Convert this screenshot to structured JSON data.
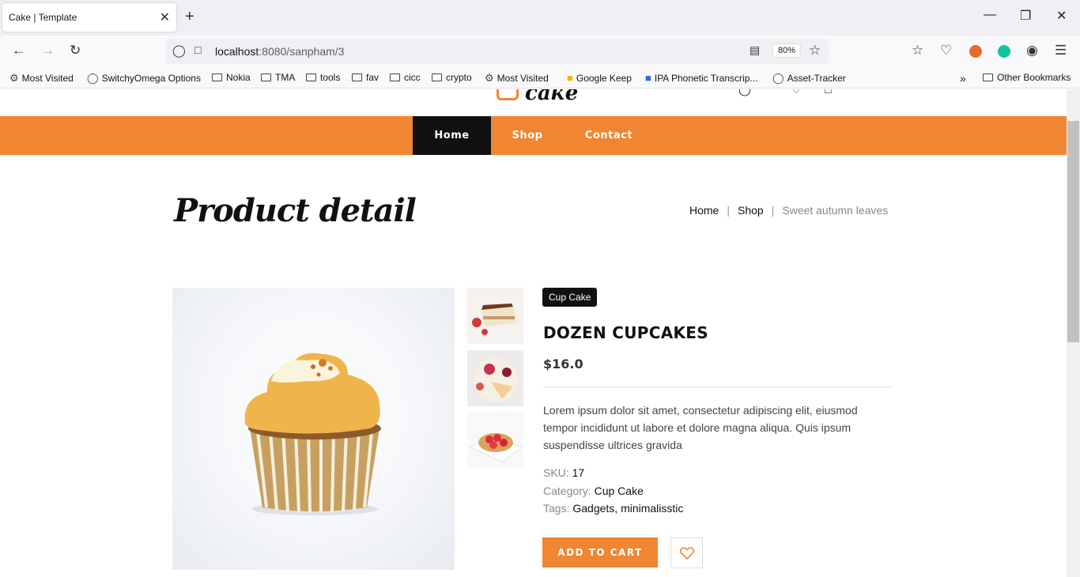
{
  "browser": {
    "tab_title": "Cake | Template",
    "tab_close": "✕",
    "new_tab": "+",
    "url_host": "localhost",
    "url_rest": ":8080/sanpham/3",
    "zoom": "80%",
    "bookmarks": [
      "Most Visited",
      "SwitchyOmega Options",
      "Nokia",
      "TMA",
      "tools",
      "fav",
      "cicc",
      "crypto",
      "Most Visited",
      "Google Keep",
      "IPA Phonetic Transcrip...",
      "Asset-Tracker"
    ],
    "other_bookmarks": "Other Bookmarks"
  },
  "site": {
    "logo": "cake",
    "menu": [
      "Home",
      "Shop",
      "Contact"
    ],
    "active_menu": "Home",
    "accent": "#f08632"
  },
  "page": {
    "title": "Product detail",
    "breadcrumb": [
      "Home",
      "Shop",
      "Sweet autumn leaves"
    ]
  },
  "product": {
    "category_badge": "Cup Cake",
    "name": "DOZEN CUPCAKES",
    "price": "$16.0",
    "description": "Lorem ipsum dolor sit amet, consectetur adipiscing elit, eiusmod tempor incididunt ut labore et dolore magna aliqua. Quis ipsum suspendisse ultrices gravida",
    "sku_label": "SKU:",
    "sku": "17",
    "category_label": "Category:",
    "category": "Cup Cake",
    "tags_label": "Tags:",
    "tags": "Gadgets, minimalisstic",
    "add_to_cart": "ADD TO CART"
  }
}
